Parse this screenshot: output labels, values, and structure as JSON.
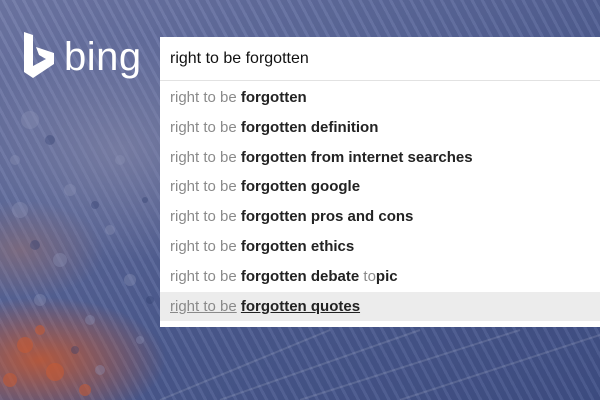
{
  "brand": {
    "logo_icon": "bing-b-icon",
    "wordmark": "bing"
  },
  "search": {
    "value": "right to be forgotten"
  },
  "suggestions": [
    {
      "prefix": "right to be",
      "bold": "forgotten",
      "light": "",
      "tail": "",
      "selected": false
    },
    {
      "prefix": "right to be",
      "bold": "forgotten definition",
      "light": "",
      "tail": "",
      "selected": false
    },
    {
      "prefix": "right to be",
      "bold": "forgotten from internet searches",
      "light": "",
      "tail": "",
      "selected": false
    },
    {
      "prefix": "right to be",
      "bold": "forgotten google",
      "light": "",
      "tail": "",
      "selected": false
    },
    {
      "prefix": "right to be",
      "bold": "forgotten pros and cons",
      "light": "",
      "tail": "",
      "selected": false
    },
    {
      "prefix": "right to be",
      "bold": "forgotten ethics",
      "light": "",
      "tail": "",
      "selected": false
    },
    {
      "prefix": "right to be",
      "bold": "forgotten debate",
      "light": "to",
      "tail": "pic",
      "selected": false
    },
    {
      "prefix": "right to be",
      "bold": "forgotten quotes",
      "light": "",
      "tail": "",
      "selected": true
    }
  ],
  "colors": {
    "dropdown_bg": "#ffffff",
    "selected_bg": "#ececec",
    "prefix_text": "#8a8a8a",
    "bold_text": "#222222",
    "wordmark": "#ffffff"
  }
}
